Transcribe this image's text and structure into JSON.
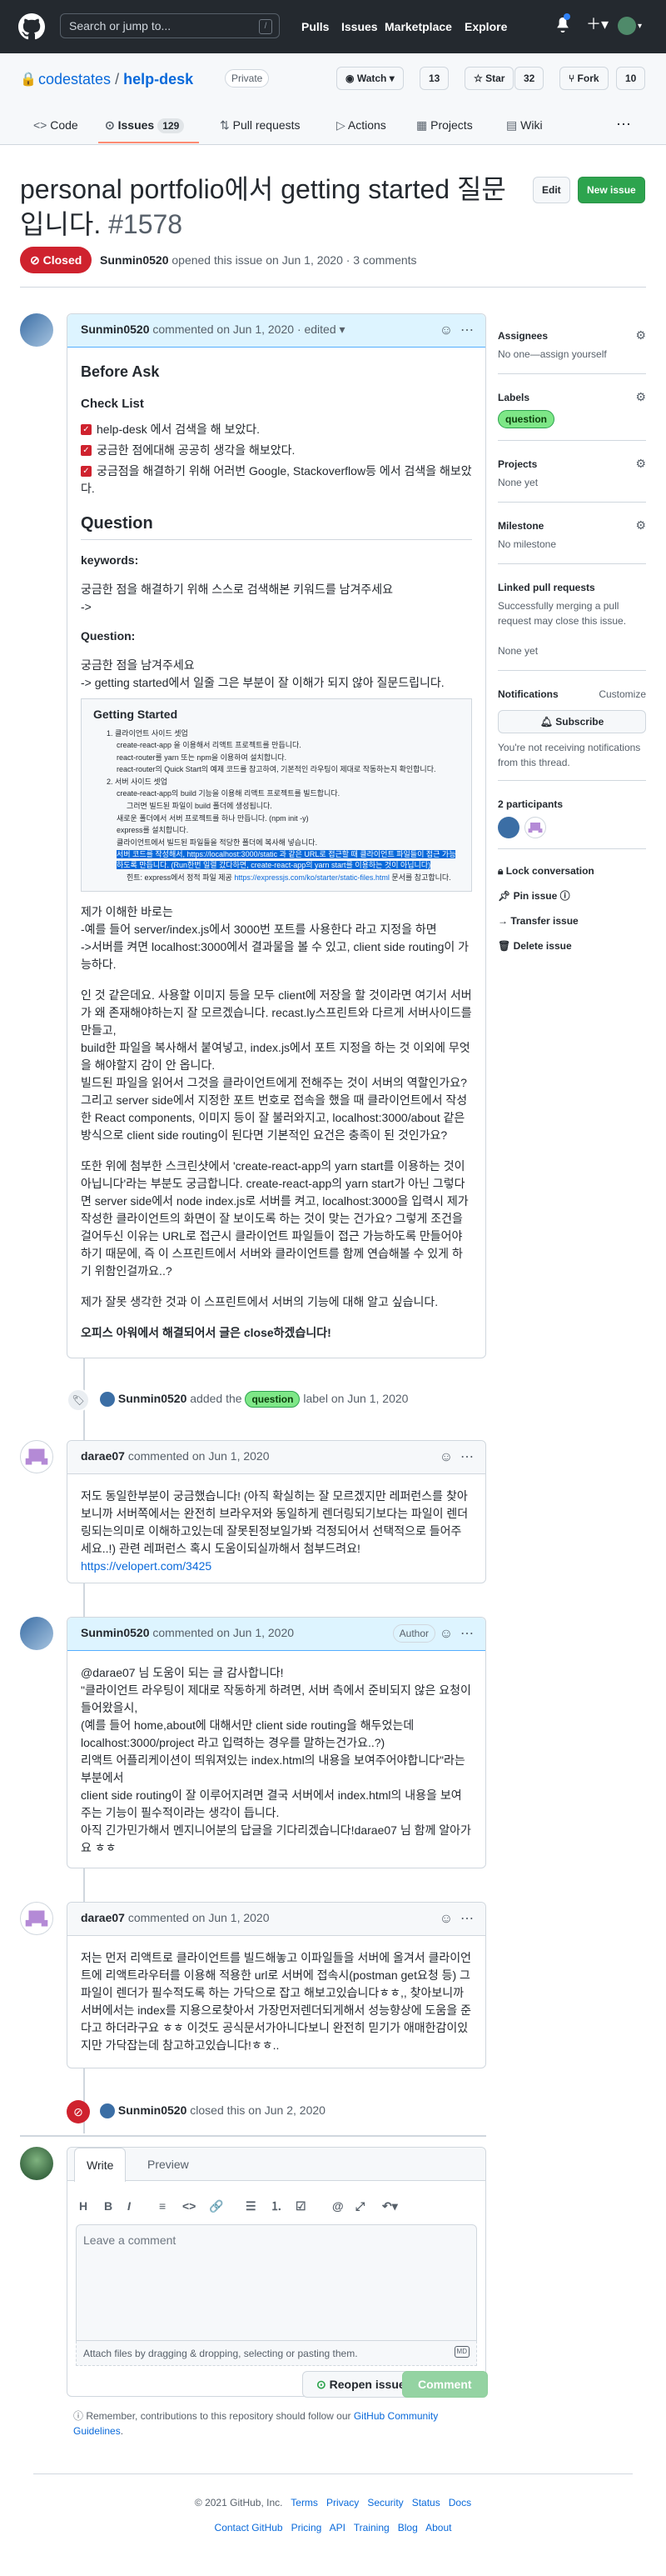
{
  "header": {
    "search_placeholder": "Search or jump to...",
    "slash_key": "/",
    "nav": [
      "Pulls",
      "Issues",
      "Marketplace",
      "Explore"
    ]
  },
  "repo": {
    "owner": "codestates",
    "separator": "/",
    "name": "help-desk",
    "visibility": "Private",
    "watch_label": "Watch",
    "watch_count": "13",
    "star_label": "Star",
    "star_count": "32",
    "fork_label": "Fork",
    "fork_count": "10",
    "tabs": {
      "code": "Code",
      "issues": "Issues",
      "issues_count": "129",
      "pulls": "Pull requests",
      "actions": "Actions",
      "projects": "Projects",
      "wiki": "Wiki"
    }
  },
  "issue": {
    "title": "personal portfolio에서 getting started 질문입니다.",
    "number": "#1578",
    "edit_label": "Edit",
    "new_issue_label": "New issue",
    "state": "Closed",
    "author": "Sunmin0520",
    "opened_text": "opened this issue on Jun 1, 2020 · 3 comments"
  },
  "first_comment": {
    "author": "Sunmin0520",
    "meta": "commented on Jun 1, 2020",
    "edited": "· edited ▾",
    "before_ask": "Before Ask",
    "checklist_title": "Check List",
    "checklist": [
      "help-desk 에서 검색을 해 보았다.",
      "궁금한 점에대해 공공히 생각을 해보았다.",
      "궁금점을 해결하기 위해 어러번 Google, Stackoverflow등 에서 검색을 해보았다."
    ],
    "question_heading": "Question",
    "keywords_label": "keywords:",
    "keywords_text": "궁금한 점을 해결하기 위해 스스로 검색해본 키워드를 남겨주세요",
    "keywords_arrow": "->",
    "question_label": "Question:",
    "question_text1": "궁금한 점을 남겨주세요",
    "question_text2": "-> getting started에서 일줄 그은 부분이 잘 이해가 되지 않아 질문드립니다.",
    "inner_title": "Getting Started",
    "inner_items": [
      "1. 클라이언트 사이드 셋업",
      "create-react-app 을 이용해서 리액트 프로젝트를 만듭니다.",
      "react-router를 yarn 또는 npm을 이용하여 설치합니다.",
      "react-router의 Quick Start의 예제 코드를 참고하여, 기본적인 라우팅이 제대로 작동하는지 확인합니다.",
      "2. 서버 사이드 셋업",
      "create-react-app의 build 기능을 이용해 리액트 프로젝트를 빌드합니다.",
      "그러면 빌드된 파일이 build 폴더에 생성됩니다.",
      "새로운 폴더에서 서버 프로젝트를 하나 만듭니다. (npm init -y)",
      "express를 설치합니다.",
      "클라이언트에서 빌드된 파일들을 적당한 폴더에 복사해 넣습니다."
    ],
    "inner_highlight": "서버 코드를 작성해서, https://localhost:3000/static 과 같은 URL로 접근할 때 클라이언트 파일들이 접근 가능하도록 만듭니다. (Run한번 일렬 갔다하면, create-react-app의 yarn start를 이용하는 것이 아닙니다)",
    "inner_hint_prefix": "힌트: express에서 정적 파일 제공",
    "inner_hint_link": "https://expressjs.com/ko/starter/static-files.html",
    "inner_hint_suffix": "문서를 참고합니다.",
    "understanding": [
      "제가 이해한 바로는",
      "-예를 들어 server/index.js에서 3000번 포트를 사용한다 라고 지정을 하면",
      "->서버를 켜면 localhost:3000에서 결과물을 볼 수 있고, client side routing이 가능하다."
    ],
    "para2": [
      "인 것 같은데요. 사용할 이미지 등을 모두 client에 저장을 할 것이라면 여기서 서버가 왜 존재해야하는지 잘 모르겠습니다. recast.ly스프린트와 다르게 서버사이드를 만들고,",
      "build한 파일을 복사해서 붙여넣고, index.js에서 포트 지정을 하는 것 이외에 무엇을 해야할지 감이 안 옵니다.",
      "빌드된 파일을 읽어서 그것을 클라이언트에게 전해주는 것이 서버의 역할인가요?",
      "그리고 server side에서 지정한 포트 번호로 접속을 했을 때 클라이언트에서 작성한 React components, 이미지 등이 잘 불러와지고, localhost:3000/about 같은 방식으로 client side routing이 된다면 기본적인 요건은 충족이 된 것인가요?"
    ],
    "para3": "또한 위에 첨부한 스크린샷에서 'create-react-app의 yarn start를 이용하는 것이 아닙니다'라는 부분도 궁금합니다. create-react-app의 yarn start가 아닌 그렇다면 server side에서 node index.js로 서버를 켜고, localhost:3000을 입력시 제가 작성한 클라이언트의 화면이 잘 보이도록 하는 것이 맞는 건가요? 그렇게 조건을 걸어두신 이유는 URL로 접근시 클라이언트 파일들이 접근 가능하도록 만들어야하기 때문에, 즉 이 스프린트에서 서버와 클라이언트를 함께 연습해볼 수 있게 하기 위함인걸까요..?",
    "para4": "제가 잘못 생각한 것과 이 스프린트에서 서버의 기능에 대해 알고 싶습니다.",
    "para5": "오피스 아워에서 해결되어서 글은 close하겠습니다!"
  },
  "label_event": {
    "actor": "Sunmin0520",
    "text_before": "added the",
    "label": "question",
    "text_after": "label on Jun 1, 2020"
  },
  "comment2": {
    "author": "darae07",
    "meta": "commented on Jun 1, 2020",
    "body": "저도 동일한부분이 궁금했습니다! (아직 확실히는 잘 모르겠지만 레퍼런스를 찾아보니까 서버쪽에서는 완전히 브라우저와 동일하게 렌더링되기보다는 파일이 렌더링되는의미로 이해하고있는데 잘못된정보일가봐 걱정되어서 선택적으로 들어주세요..!) 관련 레퍼런스 혹시 도움이되실까해서 첨부드려요!",
    "link": "https://velopert.com/3425"
  },
  "comment3": {
    "author": "Sunmin0520",
    "meta": "commented on Jun 1, 2020",
    "author_tag": "Author",
    "lines": [
      "@darae07 님 도움이 되는 글 감사합니다!",
      "\"클라이언트 라우팅이 제대로 작동하게 하려면, 서버 측에서 준비되지 않은 요청이 들어왔을시,",
      "(예를 들어 home,about에 대해서만 client side routing을 해두었는데 localhost:3000/project 라고 입력하는 경우를 말하는건가요..?)",
      "리액트 어플리케이션이 띄워져있는 index.html의 내용을 보여주어야합니다\"라는 부분에서",
      "client side routing이 잘 이루어지려면 결국 서버에서 index.html의 내용을 보여주는 기능이 필수적이라는 생각이 듭니다.",
      "아직 긴가민가해서 멘지니어분의 답글을 기다리겠습니다!darae07 님 함께 알아가요 ㅎㅎ"
    ]
  },
  "comment4": {
    "author": "darae07",
    "meta": "commented on Jun 1, 2020",
    "body": "저는 먼저 리액트로 클라이언트를 빌드해놓고 이파일들을 서버에 올겨서 클라이언트에 리액트라우터를 이용해 적용한 url로 서버에 접속시(postman get요청 등) 그 파일이 렌더가 필수적도록 하는 가닥으로 잡고 해보고있습니다ㅎㅎ,, 찾아보니까 서버에서는 index를 지용으로찾아서 가장먼저렌더되게해서 성능향상에 도움을 준다고 하더라구요 ㅎㅎ 이것도 공식문서가아니다보니 완전히 믿기가 애매한감이있지만 가닥잡는데 참고하고있습니다!ㅎㅎ.."
  },
  "closed_event": {
    "actor": "Sunmin0520",
    "text": "closed this on Jun 2, 2020"
  },
  "composer": {
    "write_tab": "Write",
    "preview_tab": "Preview",
    "placeholder": "Leave a comment",
    "attach_text": "Attach files by dragging & dropping, selecting or pasting them.",
    "md_badge": "MD",
    "reopen_label": "Reopen issue",
    "comment_label": "Comment",
    "remember_prefix": "Remember, contributions to this repository should follow our",
    "remember_link": "GitHub Community Guidelines",
    "remember_suffix": "."
  },
  "sidebar": {
    "assignees_h": "Assignees",
    "assignees_t": "No one—assign yourself",
    "labels_h": "Labels",
    "label": "question",
    "projects_h": "Projects",
    "projects_t": "None yet",
    "milestone_h": "Milestone",
    "milestone_t": "No milestone",
    "linked_h": "Linked pull requests",
    "linked_t": "Successfully merging a pull request may close this issue.",
    "linked_none": "None yet",
    "notifications_h": "Notifications",
    "customize": "Customize",
    "subscribe": "Subscribe",
    "notif_t": "You're not receiving notifications from this thread.",
    "participants_h": "2 participants",
    "lock": "Lock conversation",
    "pin": "Pin issue",
    "transfer": "Transfer issue",
    "delete": "Delete issue"
  },
  "footer": {
    "copyright": "© 2021 GitHub, Inc.",
    "row1": [
      "Terms",
      "Privacy",
      "Security",
      "Status",
      "Docs"
    ],
    "row2": [
      "Contact GitHub",
      "Pricing",
      "API",
      "Training",
      "Blog",
      "About"
    ]
  },
  "colors": {
    "header_bg": "#24292f",
    "accent_blue": "#0969da",
    "closed_red": "#cf222e",
    "label_green": "#7ee787",
    "comment_green": "#2da44e"
  }
}
